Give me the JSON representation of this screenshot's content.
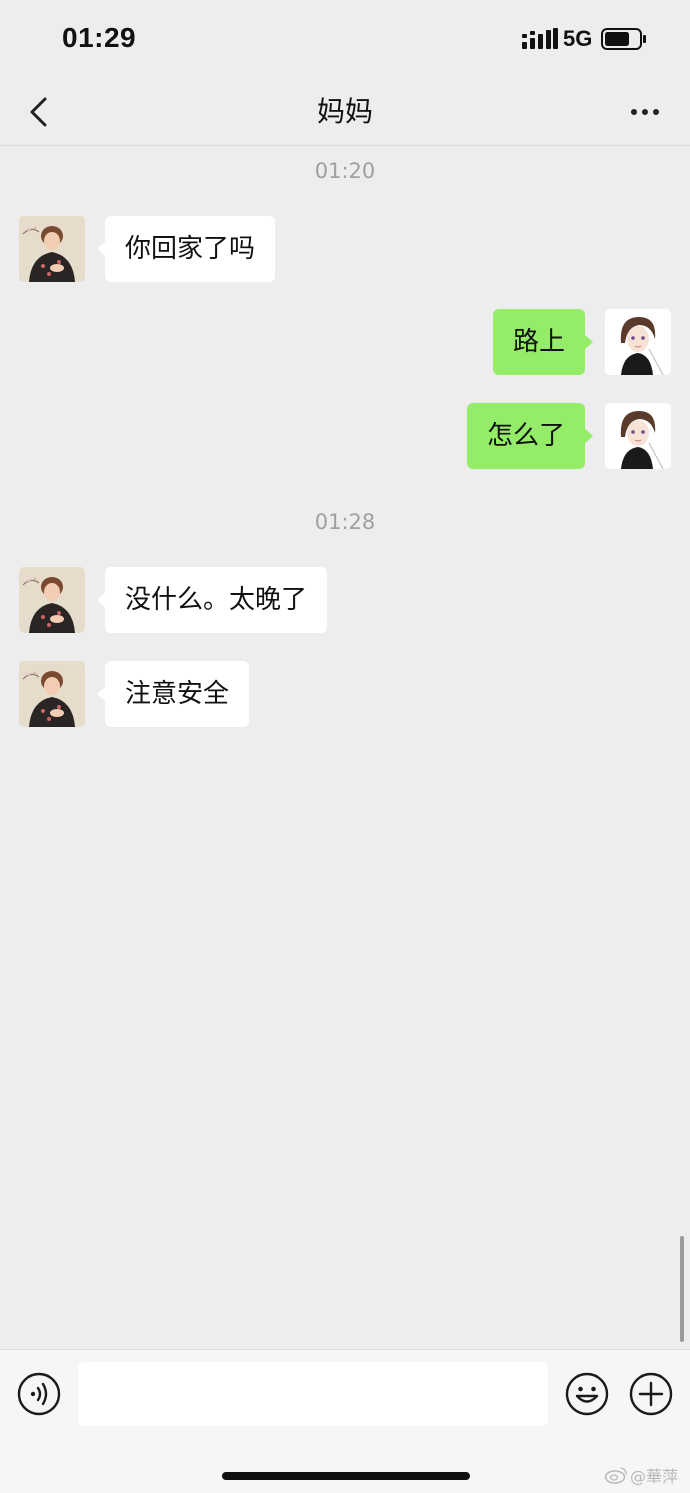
{
  "status_bar": {
    "time": "01:29",
    "network": "5G"
  },
  "nav": {
    "title": "妈妈"
  },
  "chat": {
    "timestamps": [
      "01:20",
      "01:28"
    ],
    "messages": [
      {
        "side": "in",
        "text": "你回家了吗"
      },
      {
        "side": "out",
        "text": "路上"
      },
      {
        "side": "out",
        "text": "怎么了"
      },
      {
        "side": "in",
        "text": "没什么。太晚了"
      },
      {
        "side": "in",
        "text": "注意安全"
      }
    ]
  },
  "input_bar": {
    "placeholder": ""
  },
  "watermark": {
    "handle": "@華萍"
  },
  "colors": {
    "background": "#ededed",
    "bubble_in": "#ffffff",
    "bubble_out": "#95ec69",
    "timestamp": "#a0a0a0"
  },
  "icons": [
    "back-chevron-icon",
    "more-dots-icon",
    "voice-icon",
    "emoji-icon",
    "plus-icon",
    "signal-icon",
    "battery-icon",
    "weibo-icon"
  ]
}
